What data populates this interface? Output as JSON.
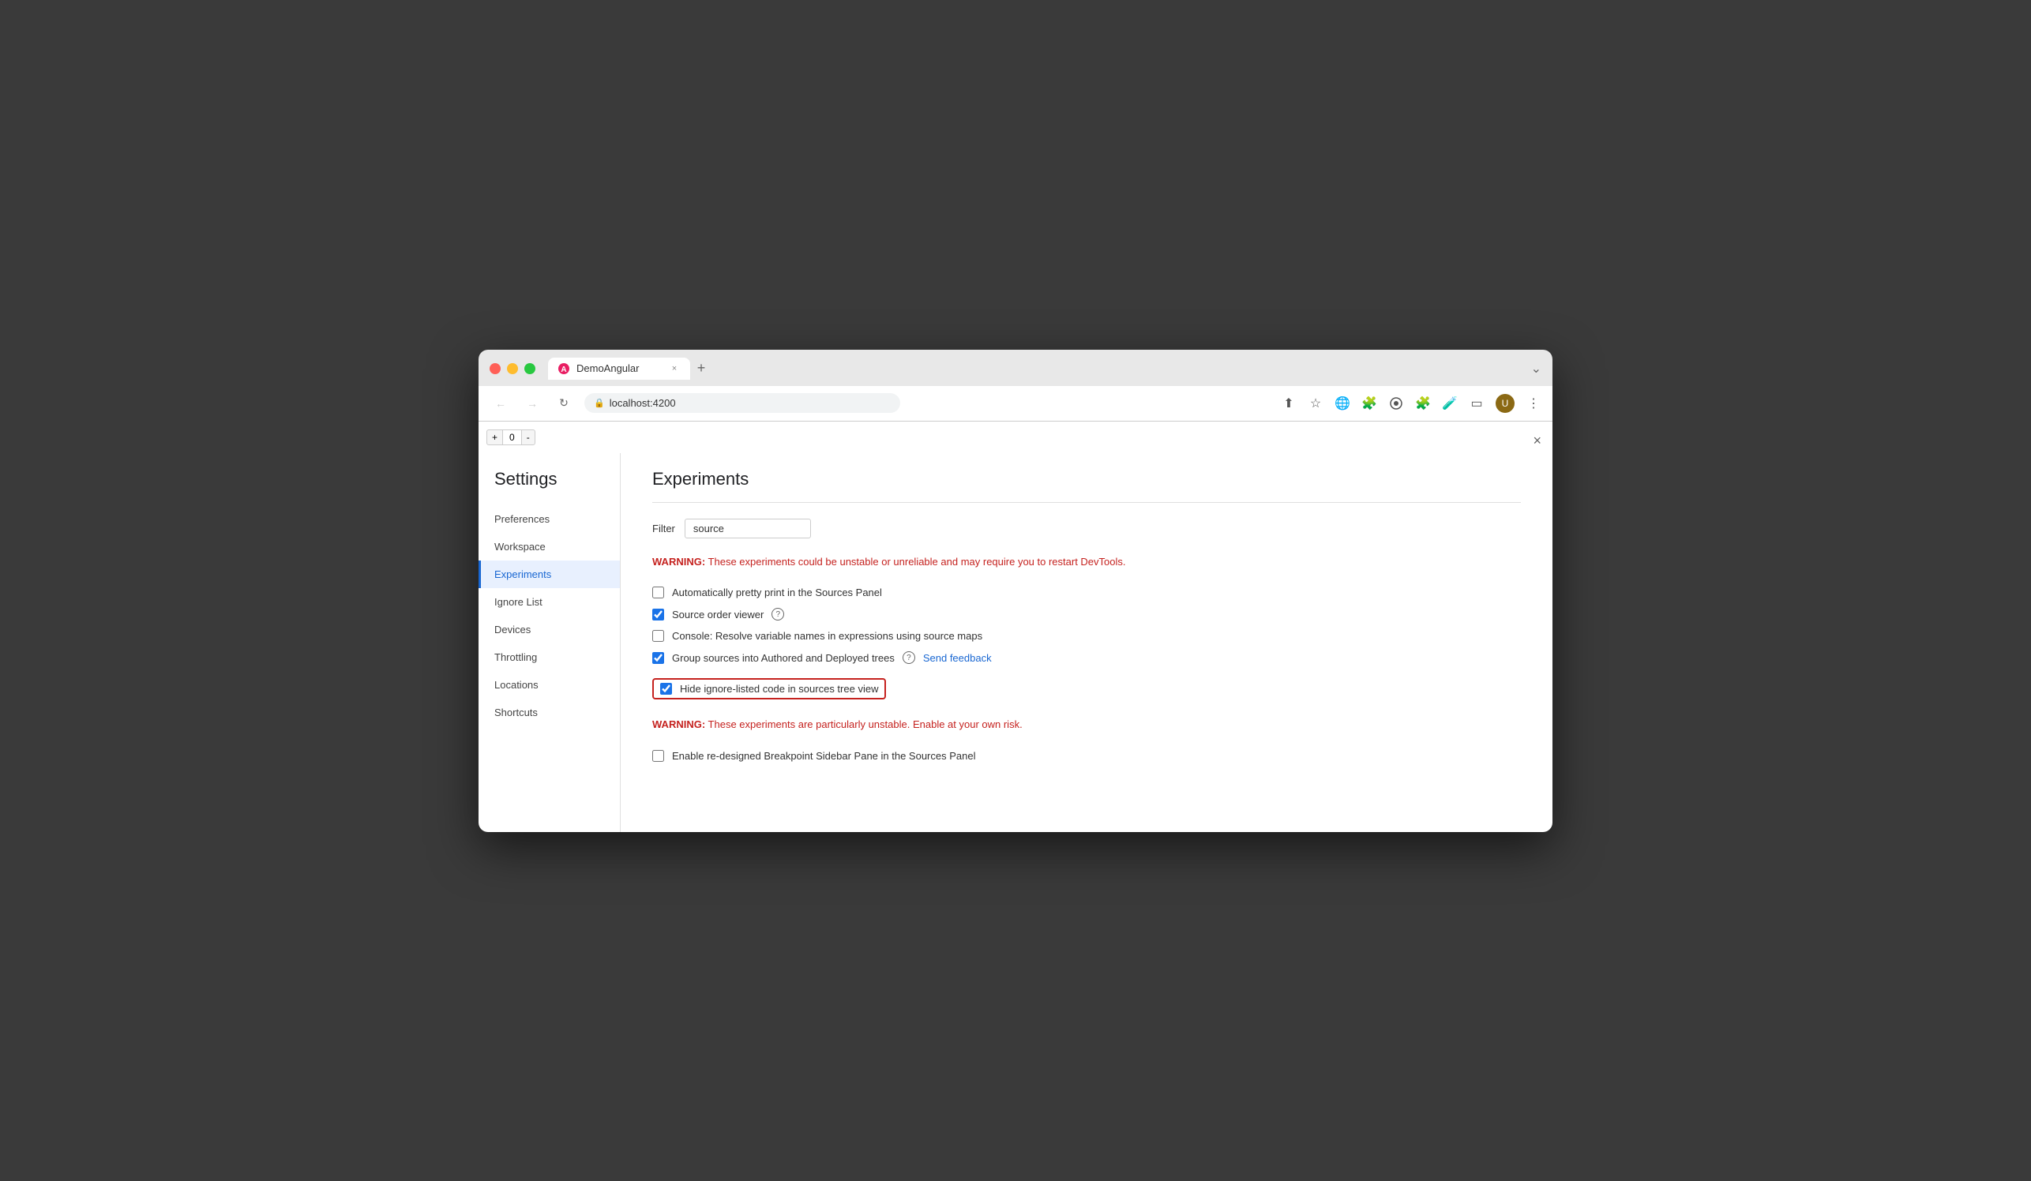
{
  "browser": {
    "tab_title": "DemoAngular",
    "tab_close": "×",
    "tab_new": "+",
    "address": "localhost:4200",
    "window_chevron": "⌄"
  },
  "toolbar": {
    "back": "←",
    "forward": "→",
    "reload": "↻"
  },
  "devtools_counter": {
    "plus": "+",
    "value": "0",
    "minus": "-"
  },
  "panel": {
    "close": "×"
  },
  "settings": {
    "title": "Settings",
    "sidebar_items": [
      {
        "id": "preferences",
        "label": "Preferences",
        "active": false
      },
      {
        "id": "workspace",
        "label": "Workspace",
        "active": false
      },
      {
        "id": "experiments",
        "label": "Experiments",
        "active": true
      },
      {
        "id": "ignore-list",
        "label": "Ignore List",
        "active": false
      },
      {
        "id": "devices",
        "label": "Devices",
        "active": false
      },
      {
        "id": "throttling",
        "label": "Throttling",
        "active": false
      },
      {
        "id": "locations",
        "label": "Locations",
        "active": false
      },
      {
        "id": "shortcuts",
        "label": "Shortcuts",
        "active": false
      }
    ]
  },
  "experiments": {
    "title": "Experiments",
    "filter_label": "Filter",
    "filter_value": "source",
    "filter_placeholder": "",
    "warning1": "WARNING:",
    "warning1_text": " These experiments could be unstable or unreliable and may require you to restart DevTools.",
    "checkbox1_label": "Automatically pretty print in the Sources Panel",
    "checkbox1_checked": false,
    "checkbox2_label": "Source order viewer",
    "checkbox2_checked": true,
    "checkbox3_label": "Console: Resolve variable names in expressions using source maps",
    "checkbox3_checked": false,
    "checkbox4_label": "Group sources into Authored and Deployed trees",
    "checkbox4_checked": true,
    "send_feedback": "Send feedback",
    "checkbox5_label": "Hide ignore-listed code in sources tree view",
    "checkbox5_checked": true,
    "warning2": "WARNING:",
    "warning2_text": " These experiments are particularly unstable. Enable at your own risk.",
    "checkbox6_label": "Enable re-designed Breakpoint Sidebar Pane in the Sources Panel",
    "checkbox6_checked": false
  }
}
